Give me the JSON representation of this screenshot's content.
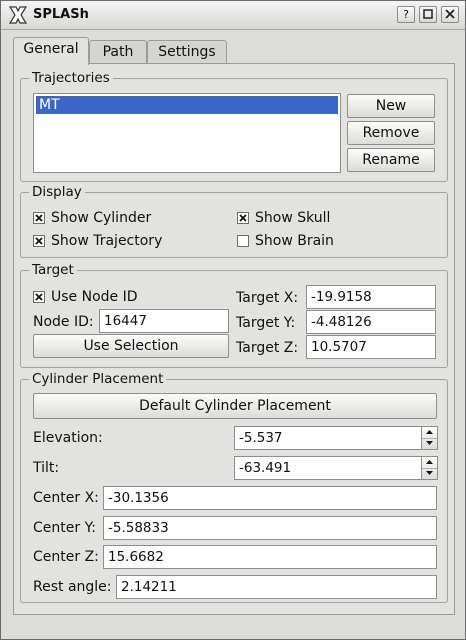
{
  "window": {
    "title": "SPLASh",
    "help_label": "?",
    "maximize_icon": "maximize-icon",
    "close_icon": "close-icon",
    "app_icon": "x-logo-icon"
  },
  "tabs": [
    {
      "label": "General",
      "active": true
    },
    {
      "label": "Path",
      "active": false
    },
    {
      "label": "Settings",
      "active": false
    }
  ],
  "trajectories": {
    "title": "Trajectories",
    "items": [
      "MT"
    ],
    "selected": "MT",
    "new_label": "New",
    "remove_label": "Remove",
    "rename_label": "Rename"
  },
  "display": {
    "title": "Display",
    "show_cylinder": {
      "label": "Show Cylinder",
      "checked": true
    },
    "show_trajectory": {
      "label": "Show Trajectory",
      "checked": true
    },
    "show_skull": {
      "label": "Show Skull",
      "checked": true
    },
    "show_brain": {
      "label": "Show Brain",
      "checked": false
    }
  },
  "target": {
    "title": "Target",
    "use_node_id": {
      "label": "Use Node ID",
      "checked": true
    },
    "node_id_label": "Node ID:",
    "node_id_value": "16447",
    "use_selection_label": "Use Selection",
    "x_label": "Target X:",
    "x_value": "-19.9158",
    "y_label": "Target Y:",
    "y_value": "-4.48126",
    "z_label": "Target Z:",
    "z_value": "10.5707"
  },
  "cylinder": {
    "title": "Cylinder Placement",
    "default_button_label": "Default Cylinder Placement",
    "elevation_label": "Elevation:",
    "elevation_value": "-5.537",
    "tilt_label": "Tilt:",
    "tilt_value": "-63.491",
    "center_x_label": "Center X:",
    "center_x_value": "-30.1356",
    "center_y_label": "Center Y:",
    "center_y_value": "-5.58833",
    "center_z_label": "Center Z:",
    "center_z_value": "15.6682",
    "rest_angle_label": "Rest angle:",
    "rest_angle_value": "2.14211"
  },
  "colors": {
    "selection": "#3a66c8",
    "panel": "#e2e2de",
    "window": "#dcdcd8"
  }
}
